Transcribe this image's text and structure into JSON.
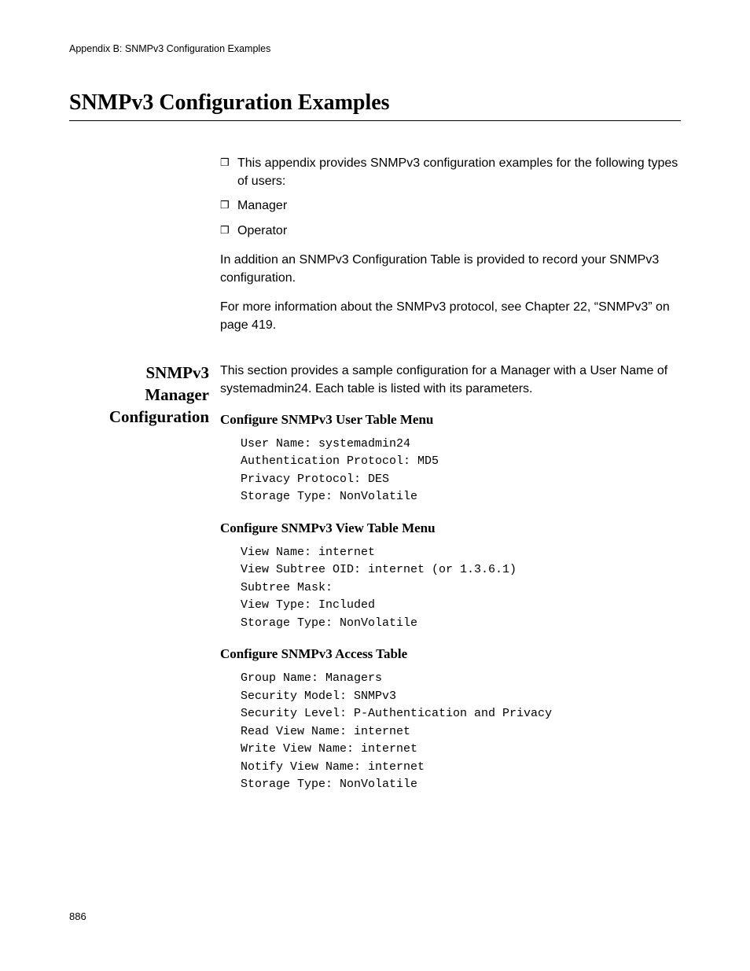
{
  "header": "Appendix B: SNMPv3 Configuration Examples",
  "title": "SNMPv3 Configuration Examples",
  "intro": {
    "bullets": [
      "This appendix provides SNMPv3 configuration examples for the following types of users:",
      "Manager",
      "Operator"
    ],
    "p1": "In addition an SNMPv3 Configuration Table is provided to record your SNMPv3 configuration.",
    "p2": "For more information about the SNMPv3 protocol, see Chapter 22, “SNMPv3” on page 419."
  },
  "section": {
    "side_l1": "SNMPv3",
    "side_l2": "Manager",
    "side_l3": "Configuration",
    "lead": "This section provides a sample configuration for a Manager with a User Name of systemadmin24. Each table is listed with its parameters.",
    "sub1": {
      "heading": "Configure SNMPv3 User Table Menu",
      "code": "User Name: systemadmin24\nAuthentication Protocol: MD5\nPrivacy Protocol: DES\nStorage Type: NonVolatile"
    },
    "sub2": {
      "heading": "Configure SNMPv3 View Table Menu",
      "code": "View Name: internet\nView Subtree OID: internet (or 1.3.6.1)\nSubtree Mask:\nView Type: Included\nStorage Type: NonVolatile"
    },
    "sub3": {
      "heading": "Configure SNMPv3 Access Table",
      "code": "Group Name: Managers\nSecurity Model: SNMPv3\nSecurity Level: P-Authentication and Privacy\nRead View Name: internet\nWrite View Name: internet\nNotify View Name: internet\nStorage Type: NonVolatile"
    }
  },
  "page_number": "886"
}
